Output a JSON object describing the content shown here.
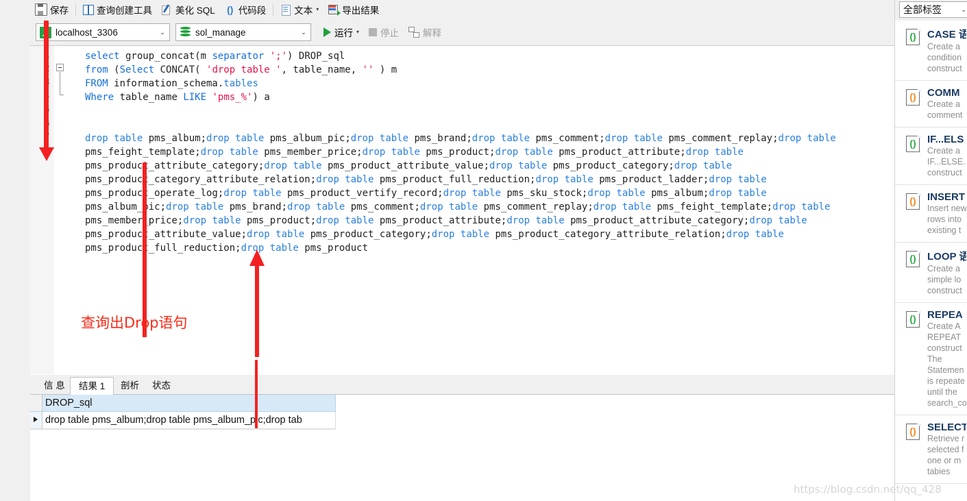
{
  "toolbar": {
    "items": [
      {
        "icon": "save-icon",
        "label": "保存",
        "caret": false
      },
      {
        "icon": "query-builder-icon",
        "label": "查询创建工具",
        "caret": false
      },
      {
        "icon": "beautify-sql-icon",
        "label": "美化 SQL",
        "caret": false
      },
      {
        "icon": "code-segment-icon",
        "label": "代码段",
        "caret": false
      },
      {
        "icon": "text-icon",
        "label": "文本",
        "caret": true
      },
      {
        "icon": "export-result-icon",
        "label": "导出结果",
        "caret": false
      }
    ],
    "code_segment_glyph": "()",
    "text_caret": "▾"
  },
  "connection_bar": {
    "connection": {
      "icon": "host-icon",
      "value": "localhost_3306",
      "arrow": "⌄"
    },
    "database": {
      "icon": "database-icon",
      "value": "sol_manage",
      "arrow": "⌄"
    },
    "run": {
      "label": "运行",
      "caret": "▾"
    },
    "stop": {
      "label": "停止"
    },
    "explain": {
      "label": "解释"
    }
  },
  "editor": {
    "line_numbers": [
      "1",
      "2",
      "3",
      "4",
      "5",
      "6",
      "7"
    ],
    "sql_lines": [
      [
        {
          "t": "select",
          "c": "kw"
        },
        {
          "t": " group_concat(m ",
          "c": "plain"
        },
        {
          "t": "separator",
          "c": "kw"
        },
        {
          "t": " ",
          "c": "plain"
        },
        {
          "t": "';'",
          "c": "str"
        },
        {
          "t": ") DROP_sql",
          "c": "plain"
        }
      ],
      [
        {
          "t": "from",
          "c": "kw"
        },
        {
          "t": " (",
          "c": "plain"
        },
        {
          "t": "Select",
          "c": "kw"
        },
        {
          "t": " CONCAT( ",
          "c": "plain"
        },
        {
          "t": "'drop table '",
          "c": "str"
        },
        {
          "t": ", table_name, ",
          "c": "plain"
        },
        {
          "t": "''",
          "c": "str"
        },
        {
          "t": " ) m",
          "c": "plain"
        }
      ],
      [
        {
          "t": "FROM",
          "c": "kw"
        },
        {
          "t": " information_schema.",
          "c": "plain"
        },
        {
          "t": "tables",
          "c": "blue"
        }
      ],
      [
        {
          "t": "Where",
          "c": "kw"
        },
        {
          "t": " table_name ",
          "c": "plain"
        },
        {
          "t": "LIKE",
          "c": "kw"
        },
        {
          "t": " ",
          "c": "plain"
        },
        {
          "t": "'pms_%'",
          "c": "str"
        },
        {
          "t": ") a",
          "c": "plain"
        }
      ],
      [],
      [],
      []
    ],
    "result_text_lines": [
      [
        {
          "t": "drop table",
          "c": "blue"
        },
        {
          "t": " pms_album;",
          "c": "plain"
        },
        {
          "t": "drop table",
          "c": "blue"
        },
        {
          "t": " pms_album_pic;",
          "c": "plain"
        },
        {
          "t": "drop table",
          "c": "blue"
        },
        {
          "t": " pms_brand;",
          "c": "plain"
        },
        {
          "t": "drop table",
          "c": "blue"
        },
        {
          "t": " pms_comment;",
          "c": "plain"
        },
        {
          "t": "drop table",
          "c": "blue"
        },
        {
          "t": " pms_comment_replay;",
          "c": "plain"
        },
        {
          "t": "drop table",
          "c": "blue"
        }
      ],
      [
        {
          "t": "pms_feight_template;",
          "c": "plain"
        },
        {
          "t": "drop table",
          "c": "blue"
        },
        {
          "t": " pms_member_price;",
          "c": "plain"
        },
        {
          "t": "drop table",
          "c": "blue"
        },
        {
          "t": " pms_product;",
          "c": "plain"
        },
        {
          "t": "drop table",
          "c": "blue"
        },
        {
          "t": " pms_product_attribute;",
          "c": "plain"
        },
        {
          "t": "drop table",
          "c": "blue"
        }
      ],
      [
        {
          "t": "pms_product_attribute_category;",
          "c": "plain"
        },
        {
          "t": "drop table",
          "c": "blue"
        },
        {
          "t": " pms_product_attribute_value;",
          "c": "plain"
        },
        {
          "t": "drop table",
          "c": "blue"
        },
        {
          "t": " pms_product_category;",
          "c": "plain"
        },
        {
          "t": "drop table",
          "c": "blue"
        }
      ],
      [
        {
          "t": "pms_product_category_attribute_relation;",
          "c": "plain"
        },
        {
          "t": "drop table",
          "c": "blue"
        },
        {
          "t": " pms_product_full_reduction;",
          "c": "plain"
        },
        {
          "t": "drop table",
          "c": "blue"
        },
        {
          "t": " pms_product_ladder;",
          "c": "plain"
        },
        {
          "t": "drop table",
          "c": "blue"
        }
      ],
      [
        {
          "t": "pms_product_operate_log;",
          "c": "plain"
        },
        {
          "t": "drop table",
          "c": "blue"
        },
        {
          "t": " pms_product_vertify_record;",
          "c": "plain"
        },
        {
          "t": "drop table",
          "c": "blue"
        },
        {
          "t": " pms_sku_stock;",
          "c": "plain"
        },
        {
          "t": "drop table",
          "c": "blue"
        },
        {
          "t": " pms_album;",
          "c": "plain"
        },
        {
          "t": "drop table",
          "c": "blue"
        }
      ],
      [
        {
          "t": "pms_album_pic;",
          "c": "plain"
        },
        {
          "t": "drop table",
          "c": "blue"
        },
        {
          "t": " pms_brand;",
          "c": "plain"
        },
        {
          "t": "drop table",
          "c": "blue"
        },
        {
          "t": " pms_comment;",
          "c": "plain"
        },
        {
          "t": "drop table",
          "c": "blue"
        },
        {
          "t": " pms_comment_replay;",
          "c": "plain"
        },
        {
          "t": "drop table",
          "c": "blue"
        },
        {
          "t": " pms_feight_template;",
          "c": "plain"
        },
        {
          "t": "drop table",
          "c": "blue"
        }
      ],
      [
        {
          "t": "pms_member_price;",
          "c": "plain"
        },
        {
          "t": "drop table",
          "c": "blue"
        },
        {
          "t": " pms_product;",
          "c": "plain"
        },
        {
          "t": "drop table",
          "c": "blue"
        },
        {
          "t": " pms_product_attribute;",
          "c": "plain"
        },
        {
          "t": "drop table",
          "c": "blue"
        },
        {
          "t": " pms_product_attribute_category;",
          "c": "plain"
        },
        {
          "t": "drop table",
          "c": "blue"
        }
      ],
      [
        {
          "t": "pms_product_attribute_value;",
          "c": "plain"
        },
        {
          "t": "drop table",
          "c": "blue"
        },
        {
          "t": " pms_product_category;",
          "c": "plain"
        },
        {
          "t": "drop table",
          "c": "blue"
        },
        {
          "t": " pms_product_category_attribute_relation;",
          "c": "plain"
        },
        {
          "t": "drop table",
          "c": "blue"
        }
      ],
      [
        {
          "t": "pms_product_full_reduction;",
          "c": "plain"
        },
        {
          "t": "drop table",
          "c": "blue"
        },
        {
          "t": " pms_product",
          "c": "plain"
        }
      ]
    ]
  },
  "annotation": {
    "text": "查询出Drop语句",
    "color": "#fb2b18"
  },
  "bottom_tabs": [
    {
      "label": "信 息",
      "active": false
    },
    {
      "label": "结果 1",
      "active": true
    },
    {
      "label": "剖析",
      "active": false
    },
    {
      "label": "状态",
      "active": false
    }
  ],
  "result_grid": {
    "column_header": "DROP_sql",
    "rows": [
      {
        "value": "drop table pms_album;drop table pms_album_pic;drop tab"
      }
    ]
  },
  "right_panel": {
    "tag_filter": {
      "label": "全部标签",
      "arrow": "⌄"
    },
    "snippets": [
      {
        "icon": "code-snippet-icon",
        "glyph": "()",
        "glyph_color": "#2eaa45",
        "title": "CASE 语",
        "desc": [
          "Create a",
          "condition",
          "construct"
        ]
      },
      {
        "icon": "code-snippet-icon",
        "glyph": "()",
        "glyph_color": "#ef8a1c",
        "title": "COMM",
        "desc": [
          "Create a",
          "comment"
        ]
      },
      {
        "icon": "code-snippet-icon",
        "glyph": "()",
        "glyph_color": "#2eaa45",
        "title": "IF...ELS",
        "desc": [
          "Create a",
          "IF...ELSE...",
          "construct"
        ]
      },
      {
        "icon": "code-snippet-icon",
        "glyph": "()",
        "glyph_color": "#ef8a1c",
        "title": "INSERT",
        "desc": [
          "Insert new",
          "rows into",
          "existing t"
        ]
      },
      {
        "icon": "code-snippet-icon",
        "glyph": "()",
        "glyph_color": "#2eaa45",
        "title": "LOOP 语",
        "desc": [
          "Create a",
          "simple lo",
          "construct"
        ]
      },
      {
        "icon": "code-snippet-icon",
        "glyph": "()",
        "glyph_color": "#2eaa45",
        "title": "REPEA",
        "desc": [
          "Create A",
          "REPEAT",
          "construct",
          "The",
          "Statemen",
          "is repeate",
          "until the",
          "search_co"
        ]
      },
      {
        "icon": "code-snippet-icon",
        "glyph": "()",
        "glyph_color": "#ef8a1c",
        "title": "SELECT",
        "desc": [
          "Retrieve r",
          "selected f",
          "one or m",
          "tabies"
        ]
      }
    ]
  },
  "watermark": "https://blog.csdn.net/qq_428"
}
